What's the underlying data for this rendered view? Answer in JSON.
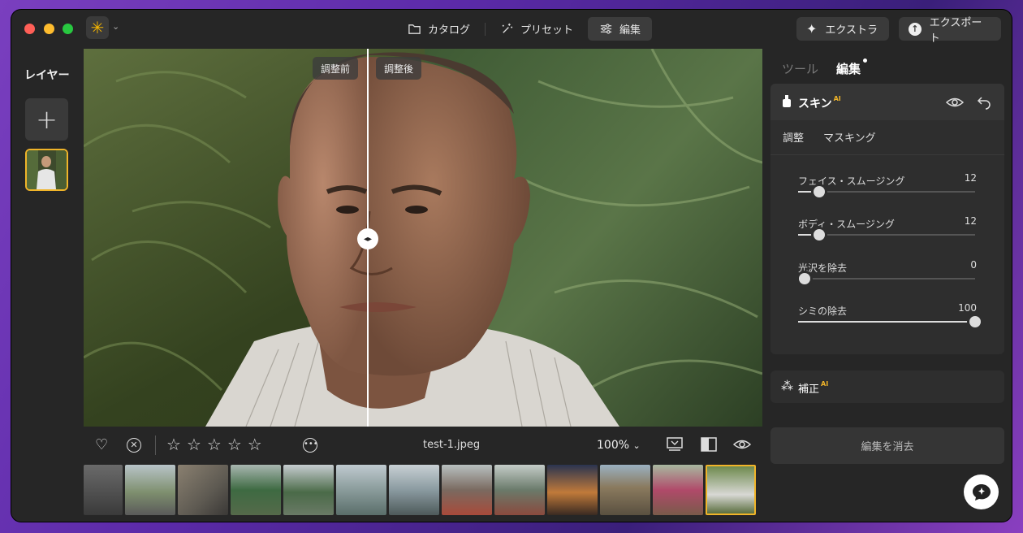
{
  "titlebar": {
    "tabs": [
      {
        "label": "カタログ",
        "icon": "folder-icon"
      },
      {
        "label": "プリセット",
        "icon": "sparkle-wand-icon"
      },
      {
        "label": "編集",
        "icon": "sliders-icon",
        "active": true
      }
    ],
    "extra_label": "エクストラ",
    "export_label": "エクスポート"
  },
  "left": {
    "title": "レイヤー",
    "add": "+"
  },
  "canvas": {
    "before_label": "調整前",
    "after_label": "調整後"
  },
  "bottombar": {
    "filename": "test-1.jpeg",
    "zoom": "100%",
    "rating": 0,
    "stars_total": 5
  },
  "right": {
    "tab_tools": "ツール",
    "tab_edit": "編集",
    "skin": {
      "title": "スキン",
      "ai_badge": "AI",
      "subtab_adjust": "調整",
      "subtab_masking": "マスキング",
      "sliders": [
        {
          "label": "フェイス・スムージング",
          "value": "12",
          "fraction": 0.12
        },
        {
          "label": "ボディ・スムージング",
          "value": "12",
          "fraction": 0.12
        },
        {
          "label": "光沢を除去",
          "value": "0",
          "fraction": 0.0
        },
        {
          "label": "シミの除去",
          "value": "100",
          "fraction": 1.0
        }
      ]
    },
    "correction": {
      "title": "補正",
      "ai_badge": "AI"
    },
    "clear_label": "編集を消去"
  },
  "colors": {
    "accent": "#f0b429",
    "window": "#262626",
    "panel": "#2e2e2e"
  }
}
